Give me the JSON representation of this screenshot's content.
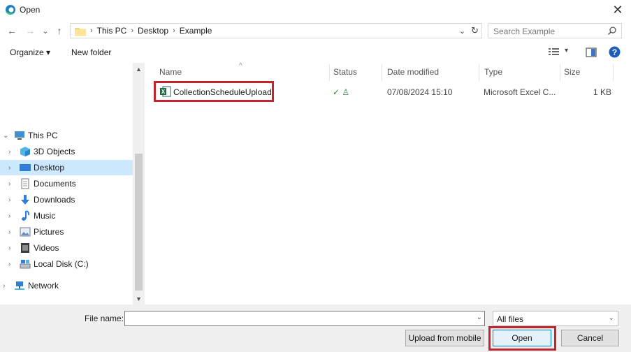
{
  "window": {
    "title": "Open",
    "close_glyph": "✕"
  },
  "nav": {
    "back": "←",
    "forward": "→",
    "recent": "⌄",
    "up": "↑",
    "breadcrumb": [
      "This PC",
      "Desktop",
      "Example"
    ],
    "breadcrumb_sep": "›",
    "address_dropdown": "⌄",
    "refresh": "↻",
    "search_placeholder": "Search Example"
  },
  "toolbar": {
    "organize": "Organize ▾",
    "new_folder": "New folder",
    "view_dropdown": "▾"
  },
  "sidebar": {
    "items": [
      {
        "label": "This PC",
        "icon": "pc-icon",
        "expanded": true
      },
      {
        "label": "3D Objects",
        "icon": "cube-icon"
      },
      {
        "label": "Desktop",
        "icon": "desktop-icon",
        "selected": true
      },
      {
        "label": "Documents",
        "icon": "document-icon"
      },
      {
        "label": "Downloads",
        "icon": "download-icon"
      },
      {
        "label": "Music",
        "icon": "music-icon"
      },
      {
        "label": "Pictures",
        "icon": "picture-icon"
      },
      {
        "label": "Videos",
        "icon": "video-icon"
      },
      {
        "label": "Local Disk (C:)",
        "icon": "disk-icon"
      },
      {
        "label": "Network",
        "icon": "network-icon"
      }
    ],
    "collapsed_chevron": "›",
    "expanded_chevron": "⌄"
  },
  "columns": [
    "Name",
    "Status",
    "Date modified",
    "Type",
    "Size"
  ],
  "sort_caret": "^",
  "files": [
    {
      "name": "CollectionScheduleUpload",
      "status": "✓ ♙",
      "date_modified": "07/08/2024 15:10",
      "type": "Microsoft Excel C...",
      "size": "1 KB"
    }
  ],
  "footer": {
    "file_name_label": "File name:",
    "file_name_value": "",
    "file_name_dropdown": "⌄",
    "filter": "All files",
    "filter_dropdown": "⌄",
    "upload_mobile": "Upload from mobile",
    "open": "Open",
    "cancel": "Cancel"
  },
  "colors": {
    "selection": "#cce8ff",
    "highlight_box": "#c0262d",
    "help_blue": "#1e5eb8",
    "excel_green": "#1d7044"
  }
}
